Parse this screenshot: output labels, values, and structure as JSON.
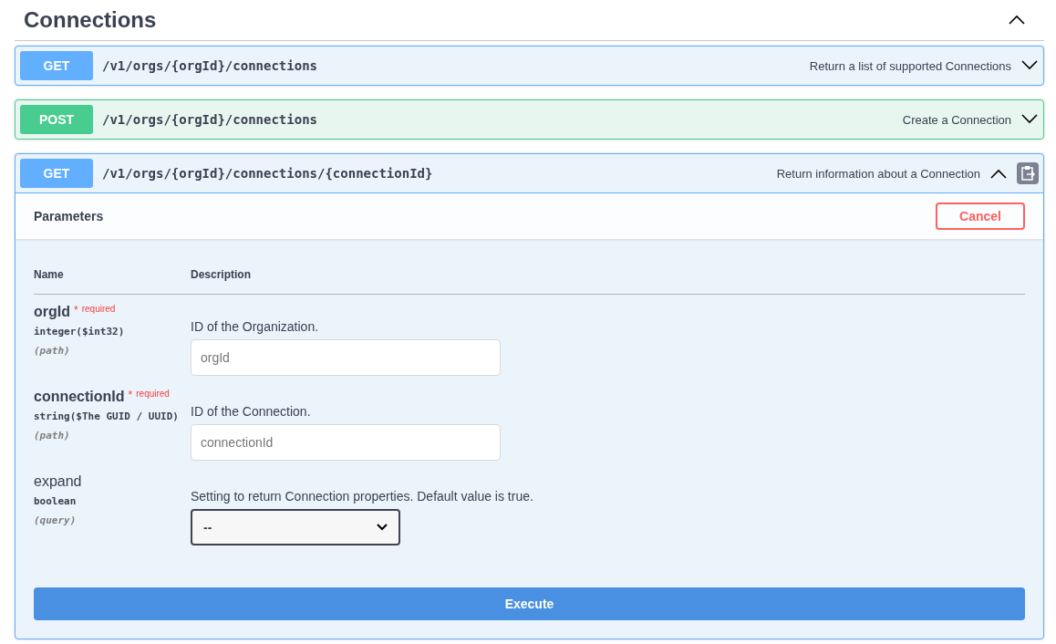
{
  "section": {
    "title": "Connections",
    "expanded": true
  },
  "operations": [
    {
      "method": "GET",
      "path": "/v1/orgs/{orgId}/connections",
      "summary": "Return a list of supported Connections",
      "expanded": false
    },
    {
      "method": "POST",
      "path": "/v1/orgs/{orgId}/connections",
      "summary": "Create a Connection",
      "expanded": false
    },
    {
      "method": "GET",
      "path": "/v1/orgs/{orgId}/connections/{connectionId}",
      "summary": "Return information about a Connection",
      "expanded": true,
      "detail": {
        "parameters_title": "Parameters",
        "cancel": "Cancel",
        "columns": [
          "Name",
          "Description"
        ],
        "parameters": [
          {
            "name": "orgId",
            "required": true,
            "required_mark": "*",
            "required_label": "required",
            "type": "integer($int32)",
            "location": "(path)",
            "description": "ID of the Organization.",
            "kind": "input",
            "placeholder": "orgId"
          },
          {
            "name": "connectionId",
            "required": true,
            "required_mark": "*",
            "required_label": "required",
            "type": "string($The GUID / UUID)",
            "location": "(path)",
            "description": "ID of the Connection.",
            "kind": "input",
            "placeholder": "connectionId"
          },
          {
            "name": "expand",
            "required": false,
            "type": "boolean",
            "location": "(query)",
            "description": "Setting to return Connection properties. Default value is true.",
            "kind": "select",
            "value": "--"
          }
        ],
        "execute": "Execute"
      }
    }
  ]
}
